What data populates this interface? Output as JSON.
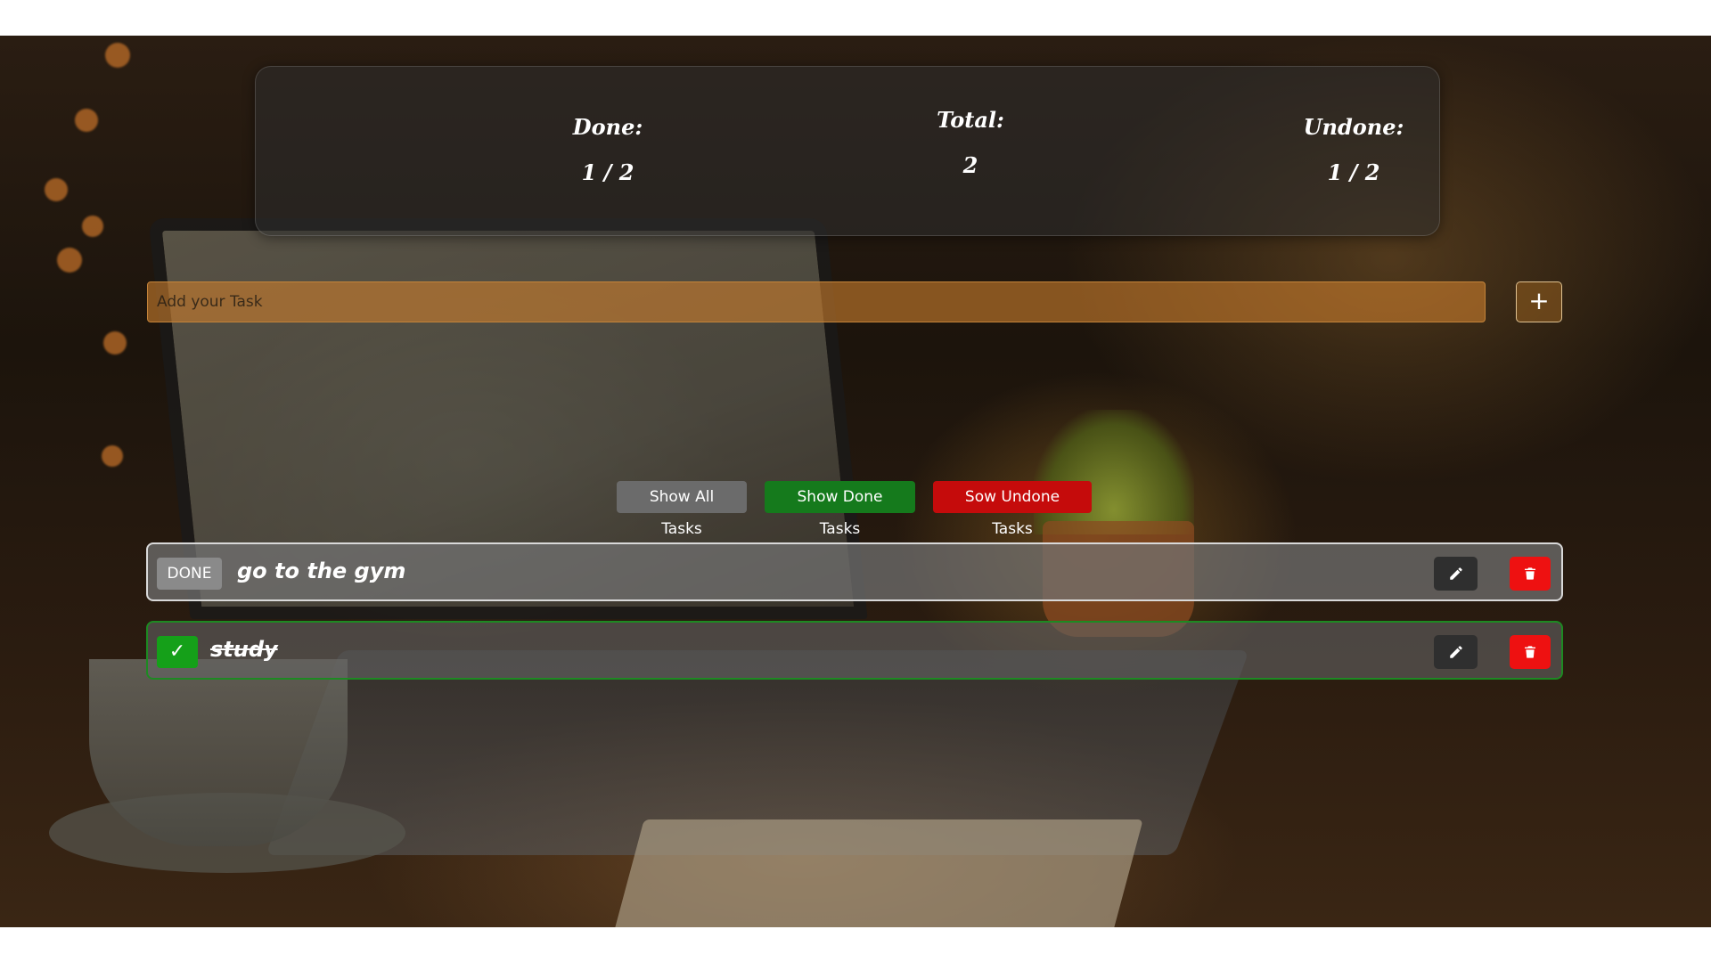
{
  "stats": {
    "done_label": "Done:",
    "done_value": "1 / 2",
    "total_label": "Total:",
    "total_value": "2",
    "undone_label": "Undone:",
    "undone_value": "1 / 2"
  },
  "add_task": {
    "placeholder": "Add your Task",
    "value": "",
    "button_icon": "plus-icon",
    "button_glyph": "+"
  },
  "filters": {
    "all_label": "Show All Tasks",
    "done_label": "Show Done Tasks",
    "undone_label": "Sow Undone Tasks"
  },
  "tasks": [
    {
      "text": "go to the gym",
      "status": "undone",
      "status_button": "DONE"
    },
    {
      "text": "study",
      "status": "done",
      "status_glyph": "✓"
    }
  ],
  "icons": {
    "edit": "pencil-icon",
    "delete": "trash-icon",
    "check": "check-icon"
  },
  "colors": {
    "done_green": "#15a019",
    "delete_red": "#ee1111",
    "filter_done": "#157a1c",
    "filter_undone": "#c50b0b",
    "input_orange": "#c87d2d"
  }
}
